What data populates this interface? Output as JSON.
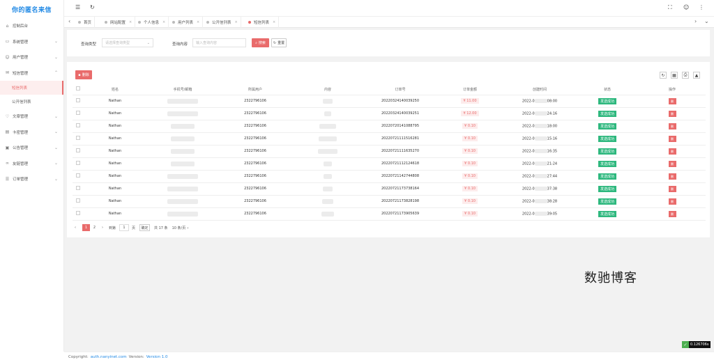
{
  "app": {
    "title": "你的匿名来信"
  },
  "sidebar": {
    "items": [
      {
        "label": "控制后台",
        "icon": "home-icon",
        "has_arrow": false
      },
      {
        "label": "系统管理",
        "icon": "monitor-icon",
        "has_arrow": true
      },
      {
        "label": "用户管理",
        "icon": "user-icon",
        "has_arrow": true
      },
      {
        "label": "短信管理",
        "icon": "message-icon",
        "has_arrow": true,
        "expanded": true
      }
    ],
    "sub_items": [
      {
        "label": "短信列表",
        "active": true
      },
      {
        "label": "公开信列表",
        "active": false
      }
    ],
    "items_after": [
      {
        "label": "文章管理",
        "icon": "heart-icon"
      },
      {
        "label": "卡密管理",
        "icon": "card-icon"
      },
      {
        "label": "公告管理",
        "icon": "notice-icon"
      },
      {
        "label": "友链管理",
        "icon": "link-icon"
      },
      {
        "label": "订单管理",
        "icon": "order-icon"
      }
    ]
  },
  "topbar": {
    "menu_icon": "☰",
    "refresh_icon": "↻",
    "fullscreen_icon": "⛶",
    "user_icon": "☺",
    "more_icon": "⋮"
  },
  "tabs": [
    {
      "label": "首页",
      "closable": false,
      "active": false
    },
    {
      "label": "网站配置",
      "closable": true,
      "active": false
    },
    {
      "label": "个人信息",
      "closable": true,
      "active": false
    },
    {
      "label": "用户列表",
      "closable": true,
      "active": false
    },
    {
      "label": "公开信列表",
      "closable": true,
      "active": false
    },
    {
      "label": "短信列表",
      "closable": true,
      "active": true
    }
  ],
  "search": {
    "type_label": "查询类型",
    "type_placeholder": "请选择查询类型",
    "content_label": "查询内容",
    "content_placeholder": "输入查询内容",
    "search_button": "搜索",
    "reset_button": "重置"
  },
  "toolbar": {
    "delete_button": "删除"
  },
  "table": {
    "columns": [
      "",
      "姓名",
      "手机号/邮箱",
      "所属用户",
      "内容",
      "订单号",
      "订单金额",
      "创建时间",
      "状态",
      "操作"
    ],
    "rows": [
      {
        "name": "Nathan",
        "user": "2322796106",
        "order": "20220324140039250",
        "amount": "¥ 11.00",
        "time_a": "2022-0",
        "time_b": "08:00",
        "status": "发送成功",
        "del": "删"
      },
      {
        "name": "Nathan",
        "user": "2322796106",
        "order": "20220324140039251",
        "amount": "¥ 12.00",
        "time_a": "2022-0",
        "time_b": "24:16",
        "status": "发送成功",
        "del": "删"
      },
      {
        "name": "Nathan",
        "user": "2322796106",
        "order": "20220720141088795",
        "amount": "¥ 0.10",
        "time_a": "2022-0",
        "time_b": "18:00",
        "status": "发送成功",
        "del": "删"
      },
      {
        "name": "Nathan",
        "user": "2322796106",
        "order": "20220721111516281",
        "amount": "¥ 0.10",
        "time_a": "2022-0",
        "time_b": "15:16",
        "status": "发送成功",
        "del": "删"
      },
      {
        "name": "Nathan",
        "user": "2322796106",
        "order": "20220721111635270",
        "amount": "¥ 0.10",
        "time_a": "2022-0",
        "time_b": "16:35",
        "status": "发送成功",
        "del": "删"
      },
      {
        "name": "Nathan",
        "user": "2322796106",
        "order": "20220721112124618",
        "amount": "¥ 0.10",
        "time_a": "2022-0",
        "time_b": "21:24",
        "status": "发送成功",
        "del": "删"
      },
      {
        "name": "Nathan",
        "user": "2322796106",
        "order": "20220721142744808",
        "amount": "¥ 0.10",
        "time_a": "2022-0",
        "time_b": "27:44",
        "status": "发送成功",
        "del": "删"
      },
      {
        "name": "Nathan",
        "user": "2322796106",
        "order": "20220721173738164",
        "amount": "¥ 0.10",
        "time_a": "2022-0",
        "time_b": "37:38",
        "status": "发送成功",
        "del": "删"
      },
      {
        "name": "Nathan",
        "user": "2322796106",
        "order": "20220721173828198",
        "amount": "¥ 0.10",
        "time_a": "2022-0",
        "time_b": "38:28",
        "status": "发送成功",
        "del": "删"
      },
      {
        "name": "Nathan",
        "user": "2322796106",
        "order": "20220721173905639",
        "amount": "¥ 0.10",
        "time_a": "2022-0",
        "time_b": "39:05",
        "status": "发送成功",
        "del": "删"
      }
    ]
  },
  "pagination": {
    "prev": "‹",
    "pages": [
      "1",
      "2"
    ],
    "current": "1",
    "next": "›",
    "goto_label": "到第",
    "goto_value": "1",
    "page_unit": "页",
    "confirm": "确定",
    "total": "共 17 条",
    "page_size": "10 条/页"
  },
  "watermark": "数驰博客",
  "footer": {
    "copyright": "Copyright:",
    "site": "auth.nanyinet.com",
    "version_label": "Version:",
    "version": "Version 1.0"
  },
  "perf_badge": "0.126706s",
  "colors": {
    "brand": "#1e88e5",
    "accent": "#e96b6b",
    "success": "#2eb87e"
  }
}
